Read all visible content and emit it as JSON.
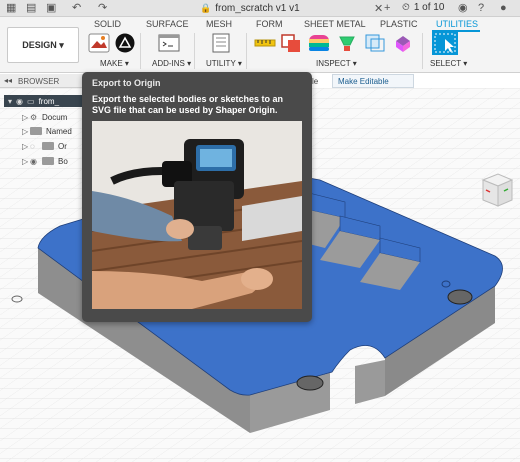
{
  "titlebar": {
    "document_title": "from_scratch v1 v1",
    "page_counter": "1 of 10"
  },
  "toolbar": {
    "tabs": [
      {
        "label": "SOLID",
        "active": false
      },
      {
        "label": "SURFACE",
        "active": false
      },
      {
        "label": "MESH",
        "active": false
      },
      {
        "label": "FORM",
        "active": false
      },
      {
        "label": "SHEET METAL",
        "active": false
      },
      {
        "label": "PLASTIC",
        "active": false
      },
      {
        "label": "UTILITIES",
        "active": true
      }
    ],
    "workspace_label": "DESIGN ▾",
    "groups": {
      "make": "MAKE ▾",
      "addins": "ADD-INS ▾",
      "utility": "UTILITY ▾",
      "inspect": "INSPECT ▾",
      "select": "SELECT ▾"
    }
  },
  "browser": {
    "title": "BROWSER",
    "root": "from_",
    "items": [
      {
        "label": "Docum"
      },
      {
        "label": "Named"
      },
      {
        "label": "Or"
      },
      {
        "label": "Bo"
      }
    ]
  },
  "header_bar": {
    "partial_text": "le",
    "make_editable_label": "Make Editable"
  },
  "tooltip": {
    "title": "Export to Origin",
    "description": "Export the selected bodies or sketches to an SVG file that can be used by Shaper Origin."
  },
  "colors": {
    "accent": "#0696d7",
    "model_top": "#3d72c9",
    "model_side": "#8c8c8c",
    "tooltip_bg": "#4a4a4a"
  }
}
